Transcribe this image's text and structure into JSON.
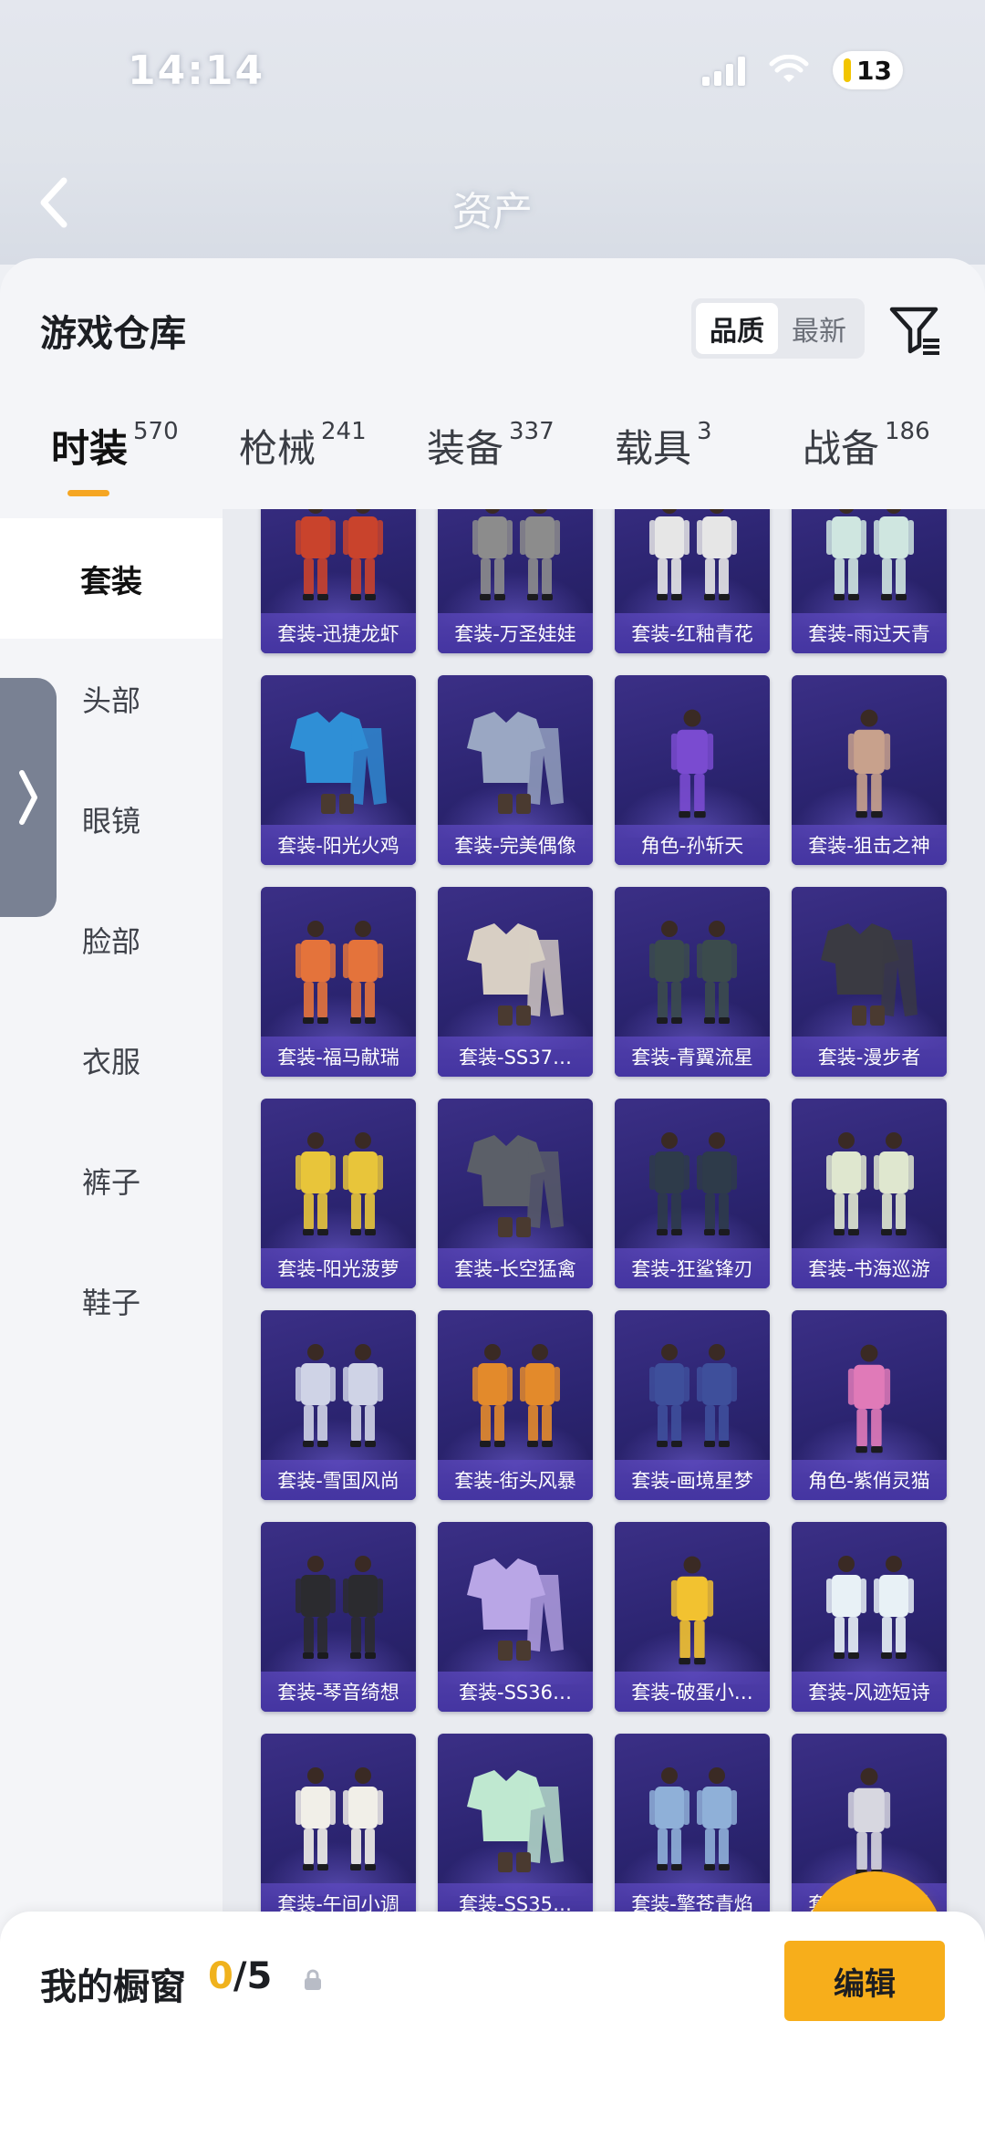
{
  "status_bar": {
    "time": "14:14",
    "battery": "13"
  },
  "nav": {
    "title": "资产"
  },
  "sheet": {
    "title": "游戏仓库"
  },
  "sort": {
    "options": [
      "品质",
      "最新"
    ],
    "selected": "品质"
  },
  "tabs": [
    {
      "label": "时装",
      "count": "570",
      "active": true
    },
    {
      "label": "枪械",
      "count": "241",
      "active": false
    },
    {
      "label": "装备",
      "count": "337",
      "active": false
    },
    {
      "label": "载具",
      "count": "3",
      "active": false
    },
    {
      "label": "战备",
      "count": "186",
      "active": false
    }
  ],
  "categories": [
    {
      "label": "套装",
      "active": true
    },
    {
      "label": "头部",
      "active": false
    },
    {
      "label": "眼镜",
      "active": false
    },
    {
      "label": "脸部",
      "active": false
    },
    {
      "label": "衣服",
      "active": false
    },
    {
      "label": "裤子",
      "active": false
    },
    {
      "label": "鞋子",
      "active": false
    }
  ],
  "items": [
    {
      "name": "套装-迅捷龙虾",
      "tint": "#c9432c",
      "figure": "pair"
    },
    {
      "name": "套装-万圣娃娃",
      "tint": "#8c8c8c",
      "figure": "pair"
    },
    {
      "name": "套装-红釉青花",
      "tint": "#e6e6e6",
      "figure": "pair"
    },
    {
      "name": "套装-雨过天青",
      "tint": "#cfe6e0",
      "figure": "pair"
    },
    {
      "name": "套装-阳光火鸡",
      "tint": "#2f8fd6",
      "figure": "outfit"
    },
    {
      "name": "套装-完美偶像",
      "tint": "#9aa7c3",
      "figure": "outfit"
    },
    {
      "name": "角色-孙斩天",
      "tint": "#7a4bd0",
      "figure": "single"
    },
    {
      "name": "套装-狙击之神",
      "tint": "#c8a18c",
      "figure": "single"
    },
    {
      "name": "套装-福马献瑞",
      "tint": "#e4733b",
      "figure": "pair"
    },
    {
      "name": "套装-SS37…",
      "tint": "#d8cfc4",
      "figure": "outfit"
    },
    {
      "name": "套装-青翼流星",
      "tint": "#3b4b4c",
      "figure": "pair"
    },
    {
      "name": "套装-漫步者",
      "tint": "#3a3a42",
      "figure": "outfit"
    },
    {
      "name": "套装-阳光菠萝",
      "tint": "#e8c53a",
      "figure": "pair"
    },
    {
      "name": "套装-长空猛禽",
      "tint": "#5b5f68",
      "figure": "outfit"
    },
    {
      "name": "套装-狂鲨锋刃",
      "tint": "#2e3b4a",
      "figure": "pair"
    },
    {
      "name": "套装-书海巡游",
      "tint": "#dfe7cf",
      "figure": "pair"
    },
    {
      "name": "套装-雪国风尚",
      "tint": "#cfd3e6",
      "figure": "pair"
    },
    {
      "name": "套装-街头风暴",
      "tint": "#e38a2b",
      "figure": "pair"
    },
    {
      "name": "套装-画境星梦",
      "tint": "#3e4f9b",
      "figure": "pair"
    },
    {
      "name": "角色-紫俏灵猫",
      "tint": "#e07ab8",
      "figure": "single"
    },
    {
      "name": "套装-琴音绮想",
      "tint": "#2b2b2f",
      "figure": "pair"
    },
    {
      "name": "套装-SS36…",
      "tint": "#b9a6e6",
      "figure": "outfit"
    },
    {
      "name": "套装-破蛋小…",
      "tint": "#f2c230",
      "figure": "single"
    },
    {
      "name": "套装-风迹短诗",
      "tint": "#e8f1f6",
      "figure": "pair"
    },
    {
      "name": "套装-午间小调",
      "tint": "#f1efe8",
      "figure": "pair"
    },
    {
      "name": "套装-SS35…",
      "tint": "#bfe8d0",
      "figure": "outfit"
    },
    {
      "name": "套装-擎苍青焰",
      "tint": "#8fb0d8",
      "figure": "pair"
    },
    {
      "name": "套装-凛凛风暴",
      "tint": "#d7d7e0",
      "figure": "single"
    },
    {
      "name": "",
      "tint": "#3b2f86",
      "figure": "none"
    },
    {
      "name": "",
      "tint": "#3b2f86",
      "figure": "none"
    },
    {
      "name": "",
      "tint": "#3b2f86",
      "figure": "none"
    },
    {
      "name": "",
      "tint": "#3b2f86",
      "figure": "none"
    }
  ],
  "showcase": {
    "title": "我的橱窗",
    "used": "0",
    "separator": "/",
    "max": "5",
    "edit_label": "编辑"
  },
  "colors": {
    "accent": "#f7ae1b",
    "card_bg": "#2b2470",
    "label_bg": "#4a38a8"
  },
  "icons": [
    "back-chevron-icon",
    "filter-icon",
    "drawer-chevron-icon",
    "share-export-icon",
    "lock-icon",
    "signal-icon",
    "wifi-icon"
  ]
}
